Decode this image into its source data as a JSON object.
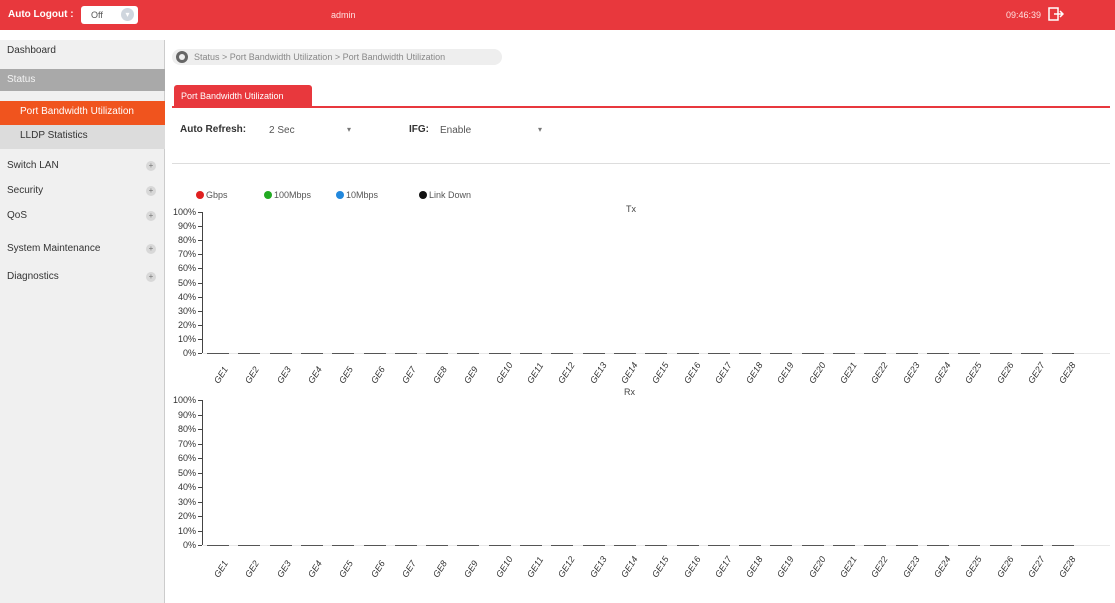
{
  "topbar": {
    "auto_logout_label": "Auto Logout :",
    "auto_logout_value": "Off",
    "username": "admin",
    "clock": "09:46:39"
  },
  "sidebar": {
    "items": [
      {
        "label": "Dashboard",
        "toggle": ""
      },
      {
        "label": "Status",
        "toggle": ""
      },
      {
        "label": "Port Bandwidth Utilization",
        "toggle": ""
      },
      {
        "label": "LLDP Statistics",
        "toggle": ""
      },
      {
        "label": "Switch LAN",
        "toggle": "+"
      },
      {
        "label": "Security",
        "toggle": "+"
      },
      {
        "label": "QoS",
        "toggle": "+"
      },
      {
        "label": "System Maintenance",
        "toggle": "+"
      },
      {
        "label": "Diagnostics",
        "toggle": "+"
      }
    ]
  },
  "breadcrumb": "Status > Port Bandwidth Utilization > Port Bandwidth Utilization",
  "tab": "Port Bandwidth Utilization",
  "form": {
    "auto_refresh_label": "Auto Refresh:",
    "auto_refresh_value": "2 Sec",
    "ifg_label": "IFG:",
    "ifg_value": "Enable"
  },
  "legend": [
    {
      "label": "Gbps",
      "color": "#e02020"
    },
    {
      "label": "100Mbps",
      "color": "#22aa22"
    },
    {
      "label": "10Mbps",
      "color": "#2288dd"
    },
    {
      "label": "Link Down",
      "color": "#111111"
    }
  ],
  "chart_data": [
    {
      "type": "bar",
      "title": "Tx",
      "categories": [
        "GE1",
        "GE2",
        "GE3",
        "GE4",
        "GE5",
        "GE6",
        "GE7",
        "GE8",
        "GE9",
        "GE10",
        "GE11",
        "GE12",
        "GE13",
        "GE14",
        "GE15",
        "GE16",
        "GE17",
        "GE18",
        "GE19",
        "GE20",
        "GE21",
        "GE22",
        "GE23",
        "GE24",
        "GE25",
        "GE26",
        "GE27",
        "GE28"
      ],
      "values": [
        0,
        0,
        0,
        0,
        0,
        0,
        0,
        0,
        0,
        0,
        0,
        0,
        0,
        0,
        0,
        0,
        0,
        0,
        0,
        0,
        0,
        0,
        0,
        0,
        0,
        0,
        0,
        0
      ],
      "yticks": [
        "100%",
        "90%",
        "80%",
        "70%",
        "60%",
        "50%",
        "40%",
        "30%",
        "20%",
        "10%",
        "0%"
      ],
      "ylim": [
        0,
        100
      ]
    },
    {
      "type": "bar",
      "title": "Rx",
      "categories": [
        "GE1",
        "GE2",
        "GE3",
        "GE4",
        "GE5",
        "GE6",
        "GE7",
        "GE8",
        "GE9",
        "GE10",
        "GE11",
        "GE12",
        "GE13",
        "GE14",
        "GE15",
        "GE16",
        "GE17",
        "GE18",
        "GE19",
        "GE20",
        "GE21",
        "GE22",
        "GE23",
        "GE24",
        "GE25",
        "GE26",
        "GE27",
        "GE28"
      ],
      "values": [
        0,
        0,
        0,
        0,
        0,
        0,
        0,
        0,
        0,
        0,
        0,
        0,
        0,
        0,
        0,
        0,
        0,
        0,
        0,
        0,
        0,
        0,
        0,
        0,
        0,
        0,
        0,
        0
      ],
      "yticks": [
        "100%",
        "90%",
        "80%",
        "70%",
        "60%",
        "50%",
        "40%",
        "30%",
        "20%",
        "10%",
        "0%"
      ],
      "ylim": [
        0,
        100
      ]
    }
  ]
}
